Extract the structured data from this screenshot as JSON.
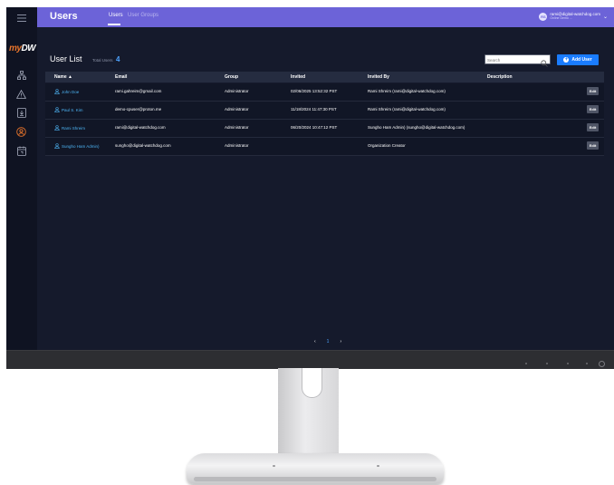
{
  "app": {
    "title": "Users",
    "tabs": [
      {
        "label": "Users",
        "active": true
      },
      {
        "label": "User Groups",
        "active": false
      }
    ],
    "logo": {
      "prefix": "my",
      "mark": "DW"
    }
  },
  "account": {
    "initials": "RS",
    "email": "rami@digital-watchdog.com",
    "org": "Online Demo ..."
  },
  "sidebar": {
    "items": [
      {
        "icon": "hamburger-menu-icon"
      },
      {
        "icon": "sitemap-icon"
      },
      {
        "icon": "alert-triangle-icon"
      },
      {
        "icon": "download-box-icon"
      },
      {
        "icon": "user-circle-icon",
        "active": true
      },
      {
        "icon": "calendar-icon"
      }
    ]
  },
  "page": {
    "heading": "User List",
    "total_label": "Total Users",
    "total_count": "4",
    "search_placeholder": "Search",
    "add_button": "Add User"
  },
  "table": {
    "columns": [
      "Name ▲",
      "Email",
      "Group",
      "Invited",
      "Invited By",
      "Description"
    ],
    "rows": [
      {
        "name": "John Doe",
        "email": "rami.gahreim@gmail.com",
        "group": "Administrator",
        "invited": "02/06/2025 13:52:32 PST",
        "invited_by": "Rami Shreim (rami@digital-watchdog.com)",
        "description": "",
        "action": "Edit"
      },
      {
        "name": "Paul S. Kim",
        "email": "demo-cpuser@proton.me",
        "group": "Administrator",
        "invited": "11/18/2024 11:47:30 PST",
        "invited_by": "Rami Shreim (rami@digital-watchdog.com)",
        "description": "",
        "action": "Edit"
      },
      {
        "name": "Rami Shreim",
        "email": "rami@digital-watchdog.com",
        "group": "Administrator",
        "invited": "06/20/2024 10:47:12 PST",
        "invited_by": "Sungho Ham Admin) (sungho@digital-watchdog.com)",
        "description": "",
        "action": "Edit"
      },
      {
        "name": "Sungho Ham Admin)",
        "email": "sungho@digital-watchdog.com",
        "group": "Administrator",
        "invited": "",
        "invited_by": "Organization Creator",
        "description": "",
        "action": "Edit"
      }
    ]
  },
  "pagination": {
    "prev": "‹",
    "current": "1",
    "next": "›"
  }
}
